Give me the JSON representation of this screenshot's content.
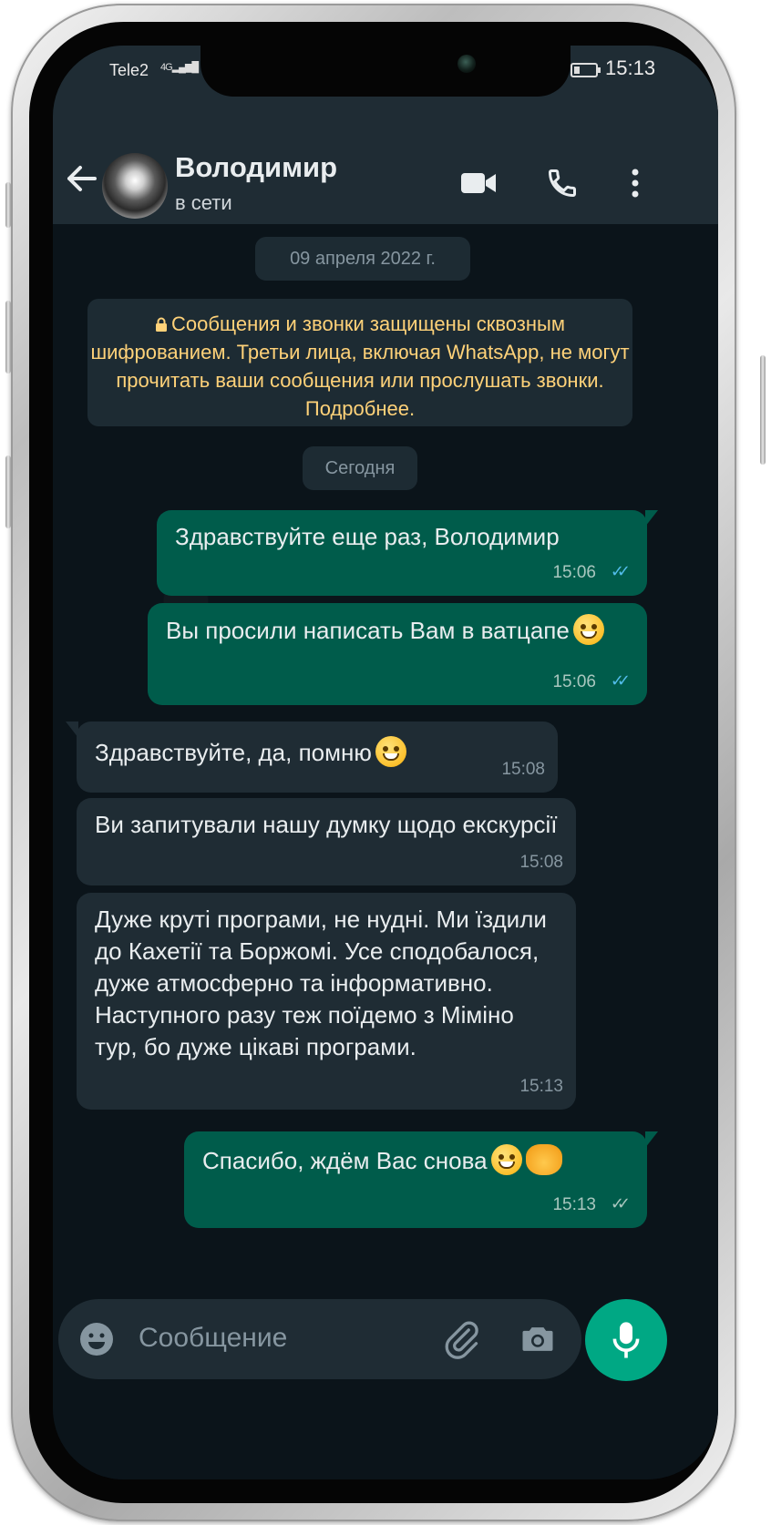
{
  "status_bar": {
    "carrier": "Tele2",
    "signal": "4G",
    "time": "15:13"
  },
  "header": {
    "contact_name": "Володимир",
    "presence": "в сети"
  },
  "chat": {
    "date_chip": "09 апреля 2022 г.",
    "encryption_notice": "Сообщения и звонки защищены сквозным шифрованием. Третьи лица, включая WhatsApp, не могут прочитать ваши сообщения или прослушать звонки. Подробнее.",
    "today_chip": "Сегодня",
    "messages": [
      {
        "direction": "out",
        "text": "Здравствуйте еще раз, Володимир",
        "time": "15:06",
        "status": "read"
      },
      {
        "direction": "out",
        "text": "Вы просили написать Вам в ватцапе",
        "emoji": "sweat-smile",
        "time": "15:06",
        "status": "read"
      },
      {
        "direction": "in",
        "text": "Здравствуйте, да, помню",
        "emoji": "grin",
        "time": "15:08"
      },
      {
        "direction": "in",
        "text": "Ви запитували нашу думку щодо екскурсії",
        "time": "15:08"
      },
      {
        "direction": "in",
        "text": "Дуже круті програми, не нудні. Ми їздили до Кахетії та Боржомі. Усе сподобалося, дуже атмосферно та інформативно. Наступного разу теж поїдемо з Міміно тур, бо дуже цікаві програми.",
        "time": "15:13"
      },
      {
        "direction": "out",
        "text": "Спасибо, ждём Вас снова",
        "emoji": "wink handshake",
        "time": "15:13",
        "status": "delivered"
      }
    ]
  },
  "composer": {
    "placeholder": "Сообщение"
  },
  "icons": {
    "back": "arrow-left-icon",
    "video": "video-call-icon",
    "call": "phone-icon",
    "menu": "more-vert-icon",
    "emoji": "smiley-icon",
    "attach": "paperclip-icon",
    "camera": "camera-icon",
    "mic": "microphone-icon",
    "lock": "lock-icon"
  },
  "colors": {
    "header_bg": "#1f2c34",
    "chat_bg": "#0b141a",
    "outgoing_bubble": "#005c4b",
    "incoming_bubble": "#1f2c34",
    "accent": "#00a884",
    "read_tick": "#53bdeb",
    "notice_text": "#ffd279"
  }
}
